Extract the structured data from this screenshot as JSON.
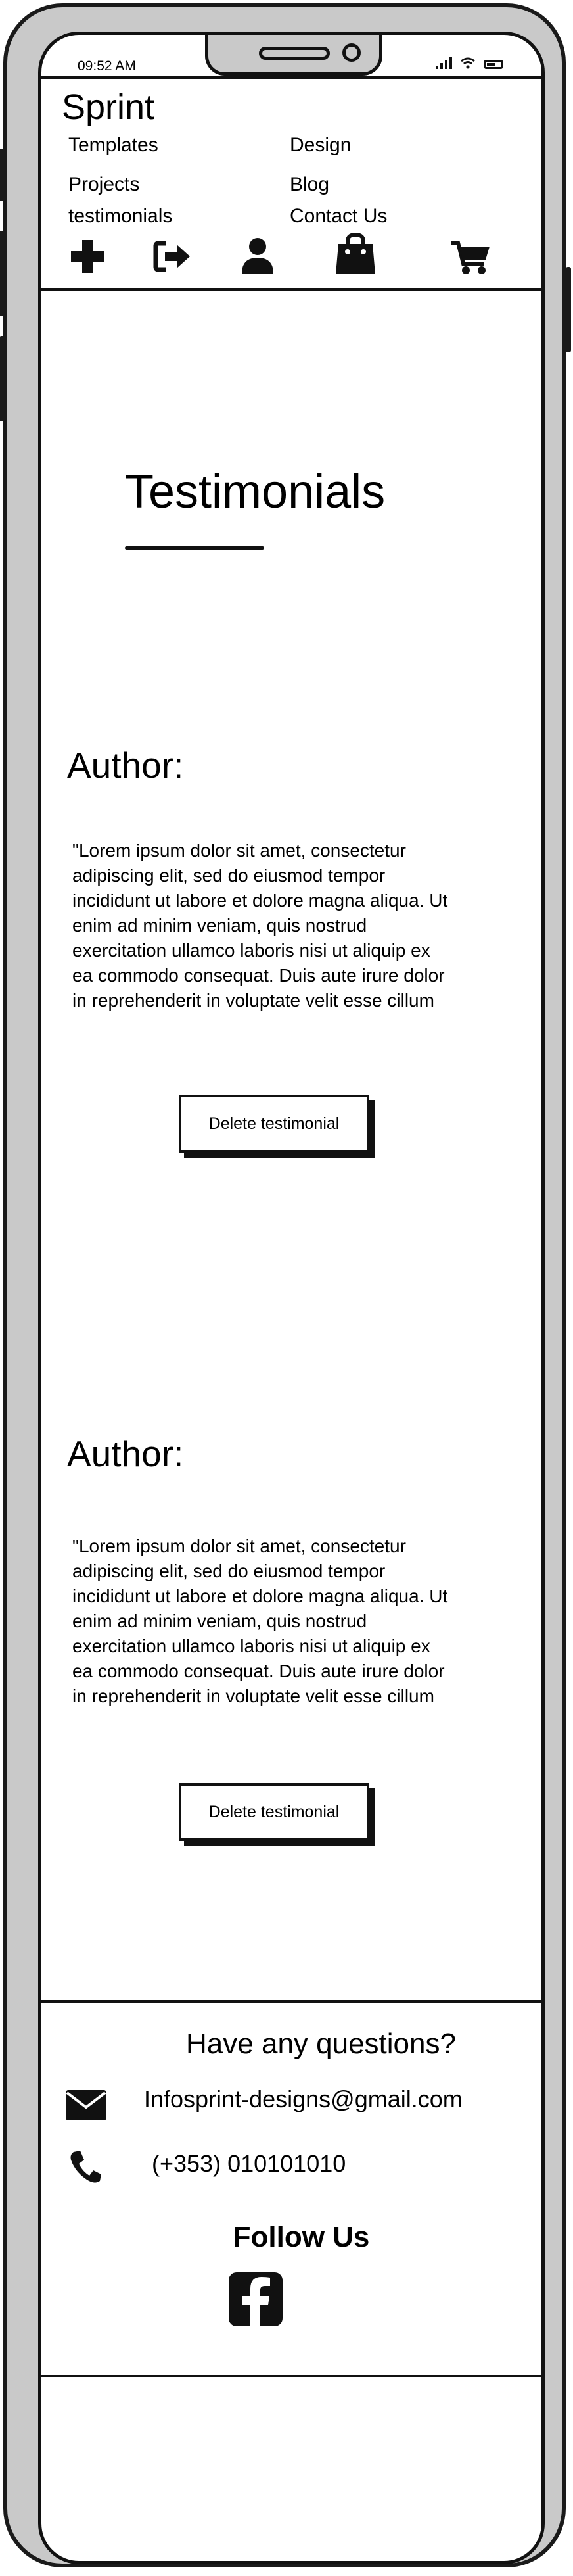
{
  "status_bar": {
    "time": "09:52 AM"
  },
  "brand": "Sprint",
  "nav": {
    "templates": "Templates",
    "design": "Design",
    "projects": "Projects",
    "blog": "Blog",
    "testimonials": "testimonials",
    "contact": "Contact Us",
    "icons": [
      "plus-icon",
      "sign-in-icon",
      "user-icon",
      "shopping-bag-icon",
      "shopping-cart-icon"
    ]
  },
  "page": {
    "title": "Testimonials"
  },
  "testimonials": [
    {
      "author_label": "Author:",
      "lines": [
        "\"Lorem ipsum dolor sit amet, consectetur",
        "adipiscing elit, sed do eiusmod tempor",
        "incididunt ut labore et dolore magna aliqua. Ut",
        "enim ad minim veniam, quis nostrud",
        "exercitation ullamco laboris nisi ut aliquip ex",
        "ea commodo consequat. Duis aute irure dolor",
        "in reprehenderit in voluptate velit esse cillum"
      ],
      "button": "Delete testimonial"
    },
    {
      "author_label": "Author:",
      "lines": [
        "\"Lorem ipsum dolor sit amet, consectetur",
        "adipiscing elit, sed do eiusmod tempor",
        "incididunt ut labore et dolore magna aliqua. Ut",
        "enim ad minim veniam, quis nostrud",
        "exercitation ullamco laboris nisi ut aliquip ex",
        "ea commodo consequat. Duis aute irure dolor",
        "in reprehenderit in voluptate velit esse cillum"
      ],
      "button": "Delete testimonial"
    }
  ],
  "footer": {
    "heading": "Have any questions?",
    "email": "Infosprint-designs@gmail.com",
    "phone": "(+353) 010101010",
    "follow": "Follow Us",
    "social_icon": "facebook-icon"
  },
  "colors": {
    "ink": "#111111",
    "frame": "#c9c9c9",
    "screen": "#ffffff"
  }
}
